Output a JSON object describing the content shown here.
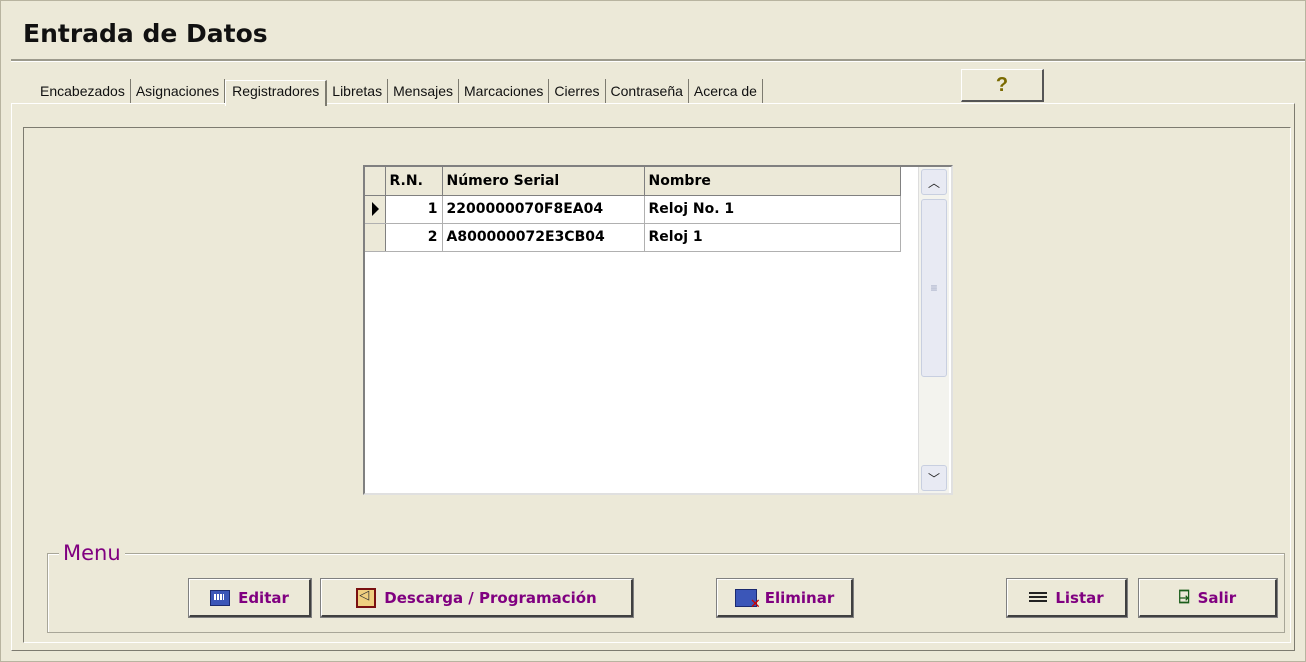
{
  "window": {
    "title": "Entrada de Datos"
  },
  "tabs": [
    {
      "label": "Encabezados",
      "active": false
    },
    {
      "label": "Asignaciones",
      "active": false
    },
    {
      "label": "Registradores",
      "active": true
    },
    {
      "label": "Libretas",
      "active": false
    },
    {
      "label": "Mensajes",
      "active": false
    },
    {
      "label": "Marcaciones",
      "active": false
    },
    {
      "label": "Cierres",
      "active": false
    },
    {
      "label": "Contraseña",
      "active": false
    },
    {
      "label": "Acerca de",
      "active": false
    }
  ],
  "help_button": {
    "label": "?"
  },
  "grid": {
    "columns": [
      "R.N.",
      "Número Serial",
      "Nombre"
    ],
    "rows": [
      {
        "rn": "1",
        "serial": "2200000070F8EA04",
        "name": "Reloj No. 1",
        "current": true
      },
      {
        "rn": "2",
        "serial": "A800000072E3CB04",
        "name": "Reloj 1",
        "current": false
      }
    ],
    "scroll_up_icon": "chevron-up-icon",
    "scroll_down_icon": "chevron-down-icon"
  },
  "menu": {
    "label": "Menu",
    "buttons": {
      "editar": "Editar",
      "descarga": "Descarga / Programación",
      "eliminar": "Eliminar",
      "listar": "Listar",
      "salir": "Salir"
    }
  },
  "colors": {
    "accent": "#800080",
    "background": "#ece9d8"
  }
}
